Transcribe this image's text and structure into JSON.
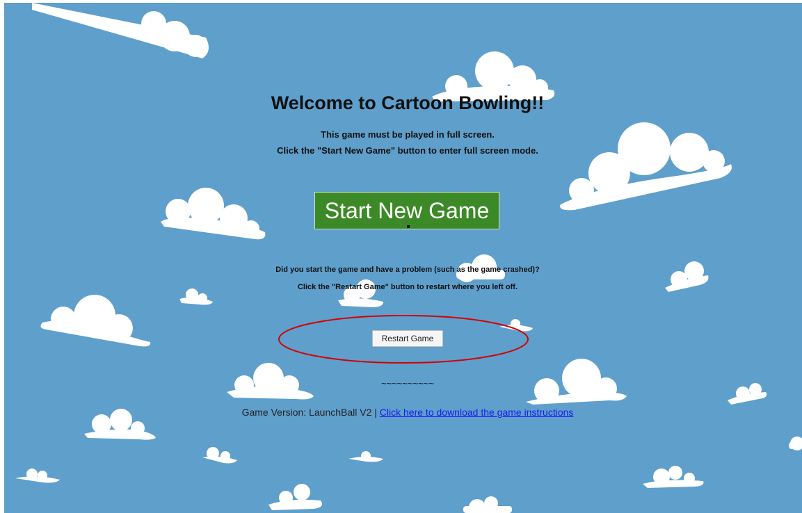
{
  "page": {
    "title": "Welcome to Cartoon Bowling!!",
    "intro_line_1": "This game must be played in full screen.",
    "intro_line_2": "Click the \"Start New Game\" button to enter full screen mode.",
    "problem_line_1": "Did you start the game and have a problem (such as the game crashed)?",
    "problem_line_2": "Click the \"Restart Game\" button to restart where you left off.",
    "divider": "~~~~~~~~~~",
    "version_text": "Game Version: LaunchBall V2 | ",
    "instructions_link": "Click here to download the game instructions"
  },
  "buttons": {
    "start_label": "Start New Game",
    "restart_label": "Restart Game"
  },
  "colors": {
    "sky": "#5f9fcc",
    "cloud": "#ffffff",
    "start_button": "#3b8a27",
    "highlight_ring": "#d40000",
    "link": "#1a1aee"
  },
  "annotations": {
    "restart_highlight": "red-ellipse-around-restart-button"
  }
}
